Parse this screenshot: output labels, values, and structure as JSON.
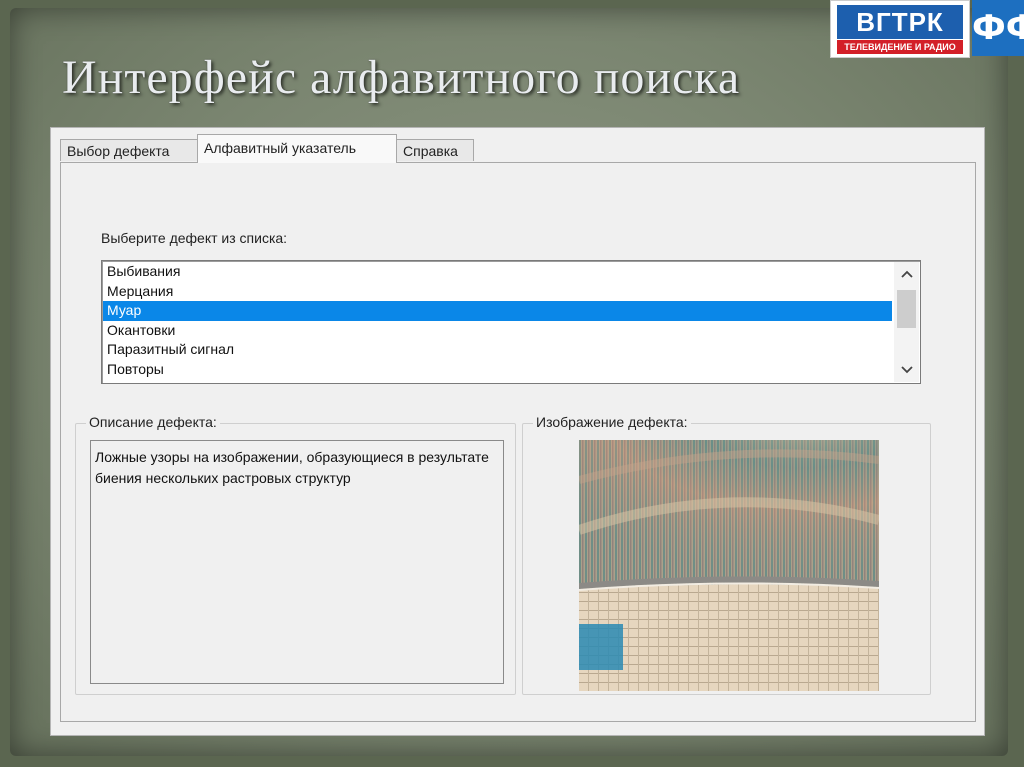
{
  "slide": {
    "title": "Интерфейс алфавитного поиска"
  },
  "logos": {
    "vgtrk_name": "ВГТРК",
    "vgtrk_tagline": "ТЕЛЕВИДЕНИЕ И РАДИО",
    "ff_mark": "ФФ"
  },
  "tabs": [
    {
      "label": "Выбор дефекта"
    },
    {
      "label": "Алфавитный указатель",
      "active": true
    },
    {
      "label": "Справка"
    }
  ],
  "panel": {
    "prompt": "Выберите дефект из списка:",
    "list_items": [
      {
        "label": "Выбивания"
      },
      {
        "label": "Мерцания"
      },
      {
        "label": "Муар",
        "selected": true
      },
      {
        "label": "Окантовки"
      },
      {
        "label": "Паразитный сигнал"
      },
      {
        "label": "Повторы"
      }
    ],
    "description_legend": "Описание дефекта:",
    "description_text": "Ложные узоры на изображении, образующиеся в результате биения нескольких растровых структур",
    "image_legend": "Изображение дефекта:"
  },
  "colors": {
    "selection": "#0a87e8",
    "logo_blue": "#1d5fae",
    "logo_red": "#d31f28"
  },
  "icons": {
    "scroll_up": "chevron-up-icon",
    "scroll_down": "chevron-down-icon"
  }
}
